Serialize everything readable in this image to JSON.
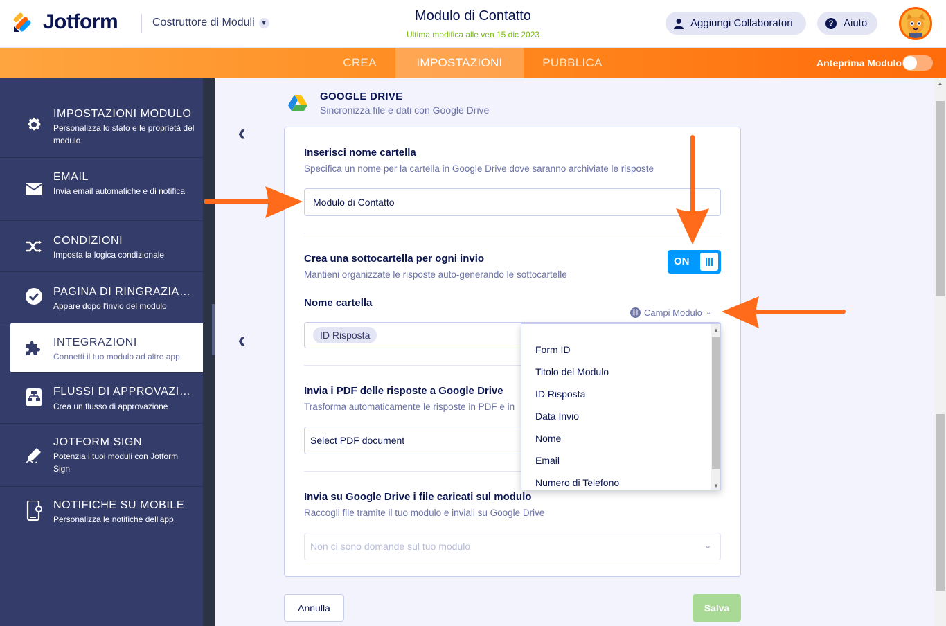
{
  "header": {
    "brand": "Jotform",
    "builder_label": "Costruttore di Moduli",
    "form_title": "Modulo di Contatto",
    "last_modified": "Ultima modifica alle ven 15 dic 2023",
    "collaborators_label": "Aggiungi Collaboratori",
    "help_label": "Aiuto"
  },
  "nav": {
    "tabs": [
      {
        "label": "CREA",
        "active": false
      },
      {
        "label": "IMPOSTAZIONI",
        "active": true
      },
      {
        "label": "PUBBLICA",
        "active": false
      }
    ],
    "preview_label": "Anteprima Modulo"
  },
  "sidebar": {
    "items": [
      {
        "title": "IMPOSTAZIONI MODULO",
        "desc": "Personalizza lo stato e le proprietà del modulo",
        "icon": "gear-icon"
      },
      {
        "title": "EMAIL",
        "desc": "Invia email automatiche e di notifica",
        "icon": "envelope-icon"
      },
      {
        "title": "CONDIZIONI",
        "desc": "Imposta la logica condizionale",
        "icon": "shuffle-icon"
      },
      {
        "title": "PAGINA DI RINGRAZIAMENTO",
        "desc": "Appare dopo l'invio del modulo",
        "icon": "check-circle-icon"
      },
      {
        "title": "INTEGRAZIONI",
        "desc": "Connetti il tuo modulo ad altre app",
        "icon": "puzzle-icon"
      },
      {
        "title": "FLUSSI DI APPROVAZIONE",
        "desc": "Crea un flusso di approvazione",
        "icon": "flow-icon"
      },
      {
        "title": "JOTFORM SIGN",
        "desc": "Potenzia i tuoi moduli con Jotform Sign",
        "icon": "pen-icon"
      },
      {
        "title": "NOTIFICHE SU MOBILE",
        "desc": "Personalizza le notifiche dell'app",
        "icon": "mobile-icon"
      }
    ]
  },
  "integration": {
    "title": "GOOGLE DRIVE",
    "subtitle": "Sincronizza file e dati con Google Drive"
  },
  "folder": {
    "label": "Inserisci nome cartella",
    "desc": "Specifica un nome per la cartella in Google Drive dove saranno archiviate le risposte",
    "value": "Modulo di Contatto"
  },
  "subfolder": {
    "label": "Crea una sottocartella per ogni invio",
    "desc": "Mantieni organizzate le risposte auto-generando le sottocartelle",
    "toggle": "ON"
  },
  "folder_name": {
    "label": "Nome cartella",
    "tag": "ID Risposta",
    "fields_label": "Campi Modulo"
  },
  "dropdown": {
    "options": [
      "Form ID",
      "Titolo del Modulo",
      "ID Risposta",
      "Data Invio",
      "Nome",
      "Email",
      "Numero di Telefono"
    ]
  },
  "pdf": {
    "label": "Invia i PDF delle risposte a Google Drive",
    "desc": "Trasforma automaticamente le risposte in PDF e in",
    "select_value": "Select PDF document"
  },
  "uploads": {
    "label": "Invia su Google Drive i file caricati sul modulo",
    "desc": "Raccogli file tramite il tuo modulo e inviali su Google Drive",
    "placeholder": "Non ci sono domande sul tuo modulo"
  },
  "buttons": {
    "cancel": "Annulla",
    "save": "Salva"
  },
  "colors": {
    "accent_orange": "#ff6100",
    "toggle_blue": "#0099ff",
    "sidebar_bg": "#343c6a",
    "save_green": "#a8d995",
    "annotation_arrow": "#ff6b1a"
  }
}
